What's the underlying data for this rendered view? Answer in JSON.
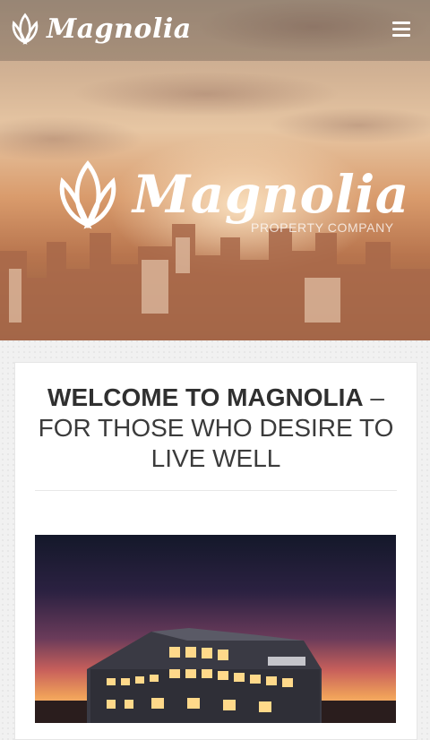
{
  "brand": {
    "name": "Magnolia",
    "tagline": "PROPERTY COMPANY"
  },
  "header": {
    "menu_icon": "hamburger-menu-icon"
  },
  "welcome": {
    "bold": "WELCOME TO MAGNOLIA",
    "rest": " – FOR THOSE WHO DESIRE TO LIVE WELL"
  },
  "colors": {
    "hero_tone": "#d9a37a",
    "heading": "#303030"
  }
}
